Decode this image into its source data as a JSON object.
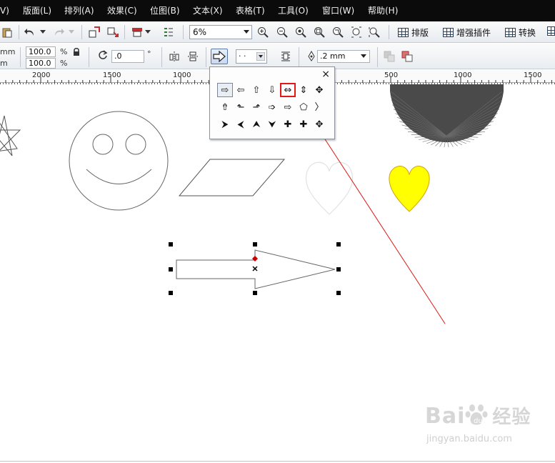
{
  "menubar": {
    "items": [
      "V)",
      "版面(L)",
      "排列(A)",
      "效果(C)",
      "位图(B)",
      "文本(X)",
      "表格(T)",
      "工具(O)",
      "窗口(W)",
      "帮助(H)"
    ]
  },
  "toolbar": {
    "zoom_value": "6%",
    "layout_label": "排版",
    "plugins_label": "增强插件",
    "convert_label": "转换"
  },
  "property_bar": {
    "unit_top": "mm",
    "unit_bottom": "m",
    "scale_x": "100.0",
    "scale_y": "100.0",
    "percent_symbol": "%",
    "rotation": ".0",
    "degree_symbol": "°",
    "outline_width": ".2 mm",
    "line_style": "· ·"
  },
  "ruler": {
    "labels": [
      "2000",
      "1500",
      "1000",
      "500",
      "1000",
      "1500"
    ]
  },
  "flyout": {
    "close_symbol": "×",
    "icons": [
      [
        "arrow-right-icon",
        "arrow-left-icon",
        "arrow-up-icon",
        "arrow-down-icon",
        "arrow-left-right-icon",
        "arrow-up-down-icon",
        "arrow-four-way-icon"
      ],
      [
        "arrow-left-up-icon",
        "arrow-bend-up-left-icon",
        "arrow-bend-up-icon",
        "arrow-striped-right-icon",
        "arrow-notched-right-icon",
        "pentagon-arrow-icon",
        "chevron-arrow-icon"
      ],
      [
        "callout-right-icon",
        "callout-left-icon",
        "callout-up-icon",
        "callout-down-icon",
        "callout-left-right-icon",
        "callout-up-down-icon",
        "callout-four-way-icon"
      ]
    ],
    "glyphs": [
      [
        "⇨",
        "⇦",
        "⇧",
        "⇩",
        "⇔",
        "⇕",
        "✥"
      ],
      [
        "⇮",
        "⬑",
        "⬏",
        "➩",
        "⇨",
        "⬠",
        "〉"
      ],
      [
        "⮞",
        "⮜",
        "⮝",
        "⮟",
        "✚",
        "✚",
        "✥"
      ]
    ]
  },
  "watermark": {
    "brand": "Bai",
    "brand_cn": "经验",
    "url": "jingyan.baidu.com"
  },
  "colors": {
    "menubar_bg": "#0b0b0b",
    "heart_fill": "#ffff00",
    "heart_stroke": "#d4a200",
    "annotation_red": "#e01818",
    "dark_semicircle": "#4a4a4a",
    "selection_handle": "#000000",
    "rotation_center_red": "#cc0000"
  }
}
